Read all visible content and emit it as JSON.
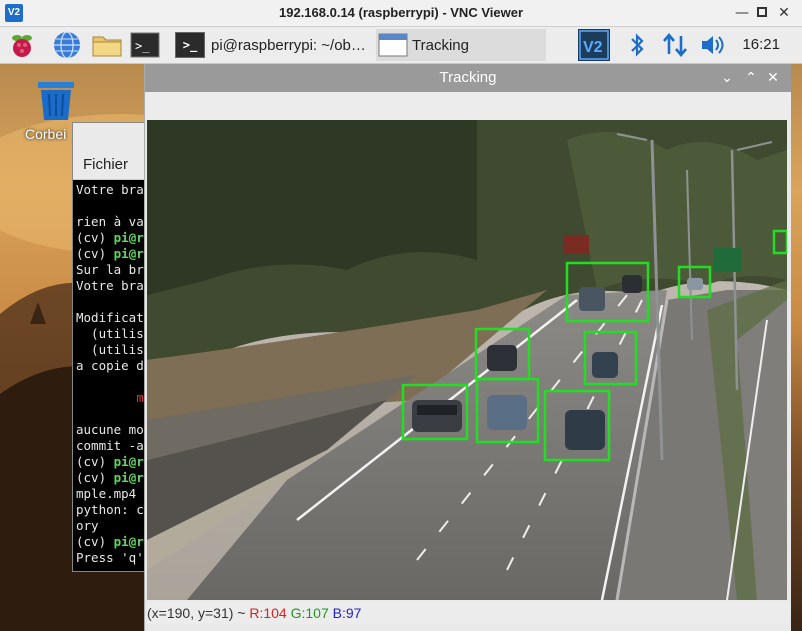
{
  "vnc": {
    "title": "192.168.0.14 (raspberrypi) - VNC Viewer",
    "logo": "V2",
    "minimize_icon": "minimize-icon",
    "restore_icon": "restore-icon",
    "close_icon": "close-icon"
  },
  "taskbar": {
    "tasks": [
      {
        "label": "pi@raspberrypi: ~/ob…",
        "icon": "terminal-icon"
      },
      {
        "label": "Tracking",
        "icon": "window-icon"
      }
    ],
    "clock": "16:21",
    "vnc_tray": "V2"
  },
  "desktop": {
    "trash_label": "Corbei"
  },
  "terminal": {
    "menu_label": "Fichier",
    "lines": [
      {
        "text": "Votre bra",
        "prompt": "",
        "alert": false
      },
      {
        "text": "",
        "prompt": "",
        "alert": false
      },
      {
        "text": "rien à va",
        "prompt": "",
        "alert": false
      },
      {
        "text": "(cv) ",
        "prompt": "pi@r",
        "alert": false
      },
      {
        "text": "(cv) ",
        "prompt": "pi@r",
        "alert": false
      },
      {
        "text": "Sur la br",
        "prompt": "",
        "alert": false
      },
      {
        "text": "Votre bra",
        "prompt": "",
        "alert": false
      },
      {
        "text": "",
        "prompt": "",
        "alert": false
      },
      {
        "text": "Modificat",
        "prompt": "",
        "alert": false
      },
      {
        "text": "  (utilis",
        "prompt": "",
        "alert": false
      },
      {
        "text": "  (utilis",
        "prompt": "",
        "alert": false
      },
      {
        "text": "a copie d",
        "prompt": "",
        "alert": false
      },
      {
        "text": "",
        "prompt": "",
        "alert": false
      },
      {
        "text": "        m",
        "prompt": "",
        "alert": true
      },
      {
        "text": "",
        "prompt": "",
        "alert": false
      },
      {
        "text": "aucune mo",
        "prompt": "",
        "alert": false
      },
      {
        "text": "commit -a",
        "prompt": "",
        "alert": false
      },
      {
        "text": "(cv) ",
        "prompt": "pi@r",
        "alert": false
      },
      {
        "text": "(cv) ",
        "prompt": "pi@r",
        "alert": false
      },
      {
        "text": "mple.mp4",
        "prompt": "",
        "alert": false
      },
      {
        "text": "python: c",
        "prompt": "",
        "alert": false
      },
      {
        "text": "ory",
        "prompt": "",
        "alert": false
      },
      {
        "text": "(cv) ",
        "prompt": "pi@r",
        "alert": false
      },
      {
        "text": "Press 'q'",
        "prompt": "",
        "alert": false
      }
    ]
  },
  "tracking": {
    "title": "Tracking",
    "status": {
      "coords": "(x=190, y=31) ~ ",
      "r": "R:104",
      "g": "G:107",
      "b": "B:97"
    },
    "detections_count": 10
  },
  "colors": {
    "detection_box": "#22dd22",
    "vnc_blue": "#1c6ec8"
  }
}
